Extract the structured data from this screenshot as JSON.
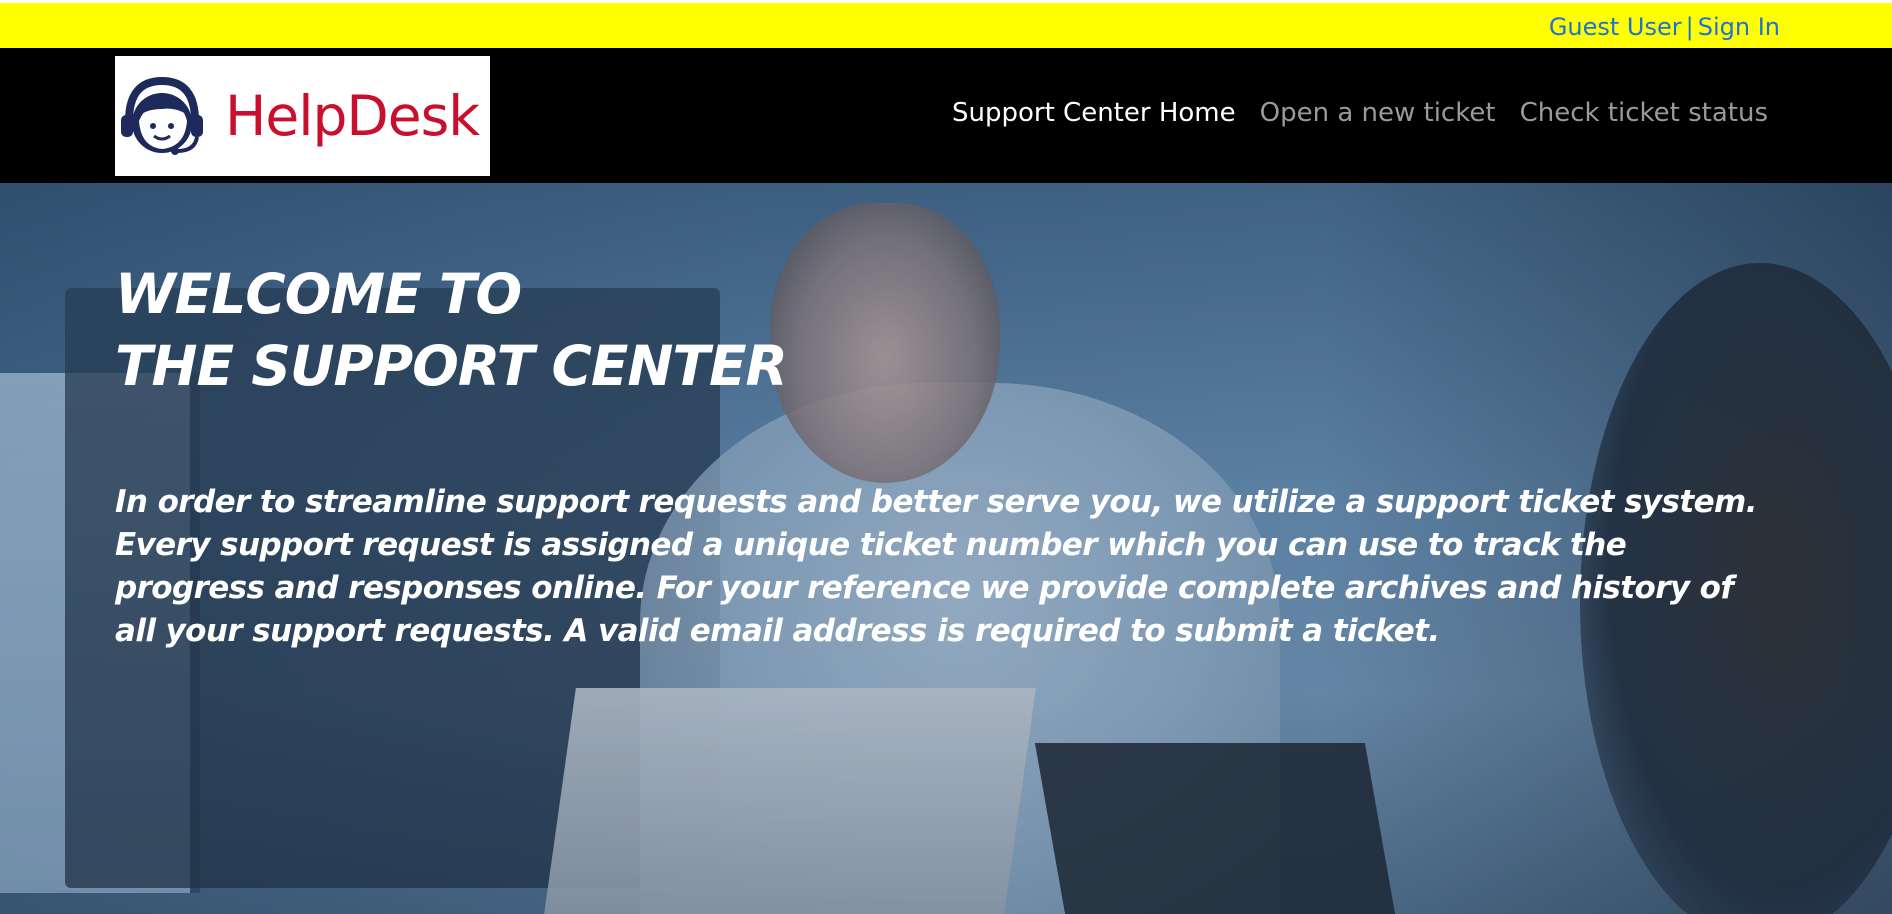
{
  "topbar": {
    "background_color": "#ffff00",
    "link_color": "#1e73d2",
    "guest_label": "Guest User",
    "separator": "|",
    "sign_in_label": "Sign In"
  },
  "header": {
    "background_color": "#000000",
    "logo": {
      "text": "HelpDesk",
      "text_color": "#c8102e",
      "icon": "support-agent-headset-icon"
    },
    "nav": [
      {
        "label": "Support Center Home",
        "active": true
      },
      {
        "label": "Open a new ticket",
        "active": false
      },
      {
        "label": "Check ticket status",
        "active": false
      }
    ]
  },
  "hero": {
    "title_line1": "WELCOME TO",
    "title_line2": "THE SUPPORT CENTER",
    "description": "In order to streamline support requests and better serve you, we utilize a support ticket system. Every support request is assigned a unique ticket number which you can use to track the progress and responses online. For your reference we provide complete archives and history of all your support requests. A valid email address is required to submit a ticket."
  }
}
